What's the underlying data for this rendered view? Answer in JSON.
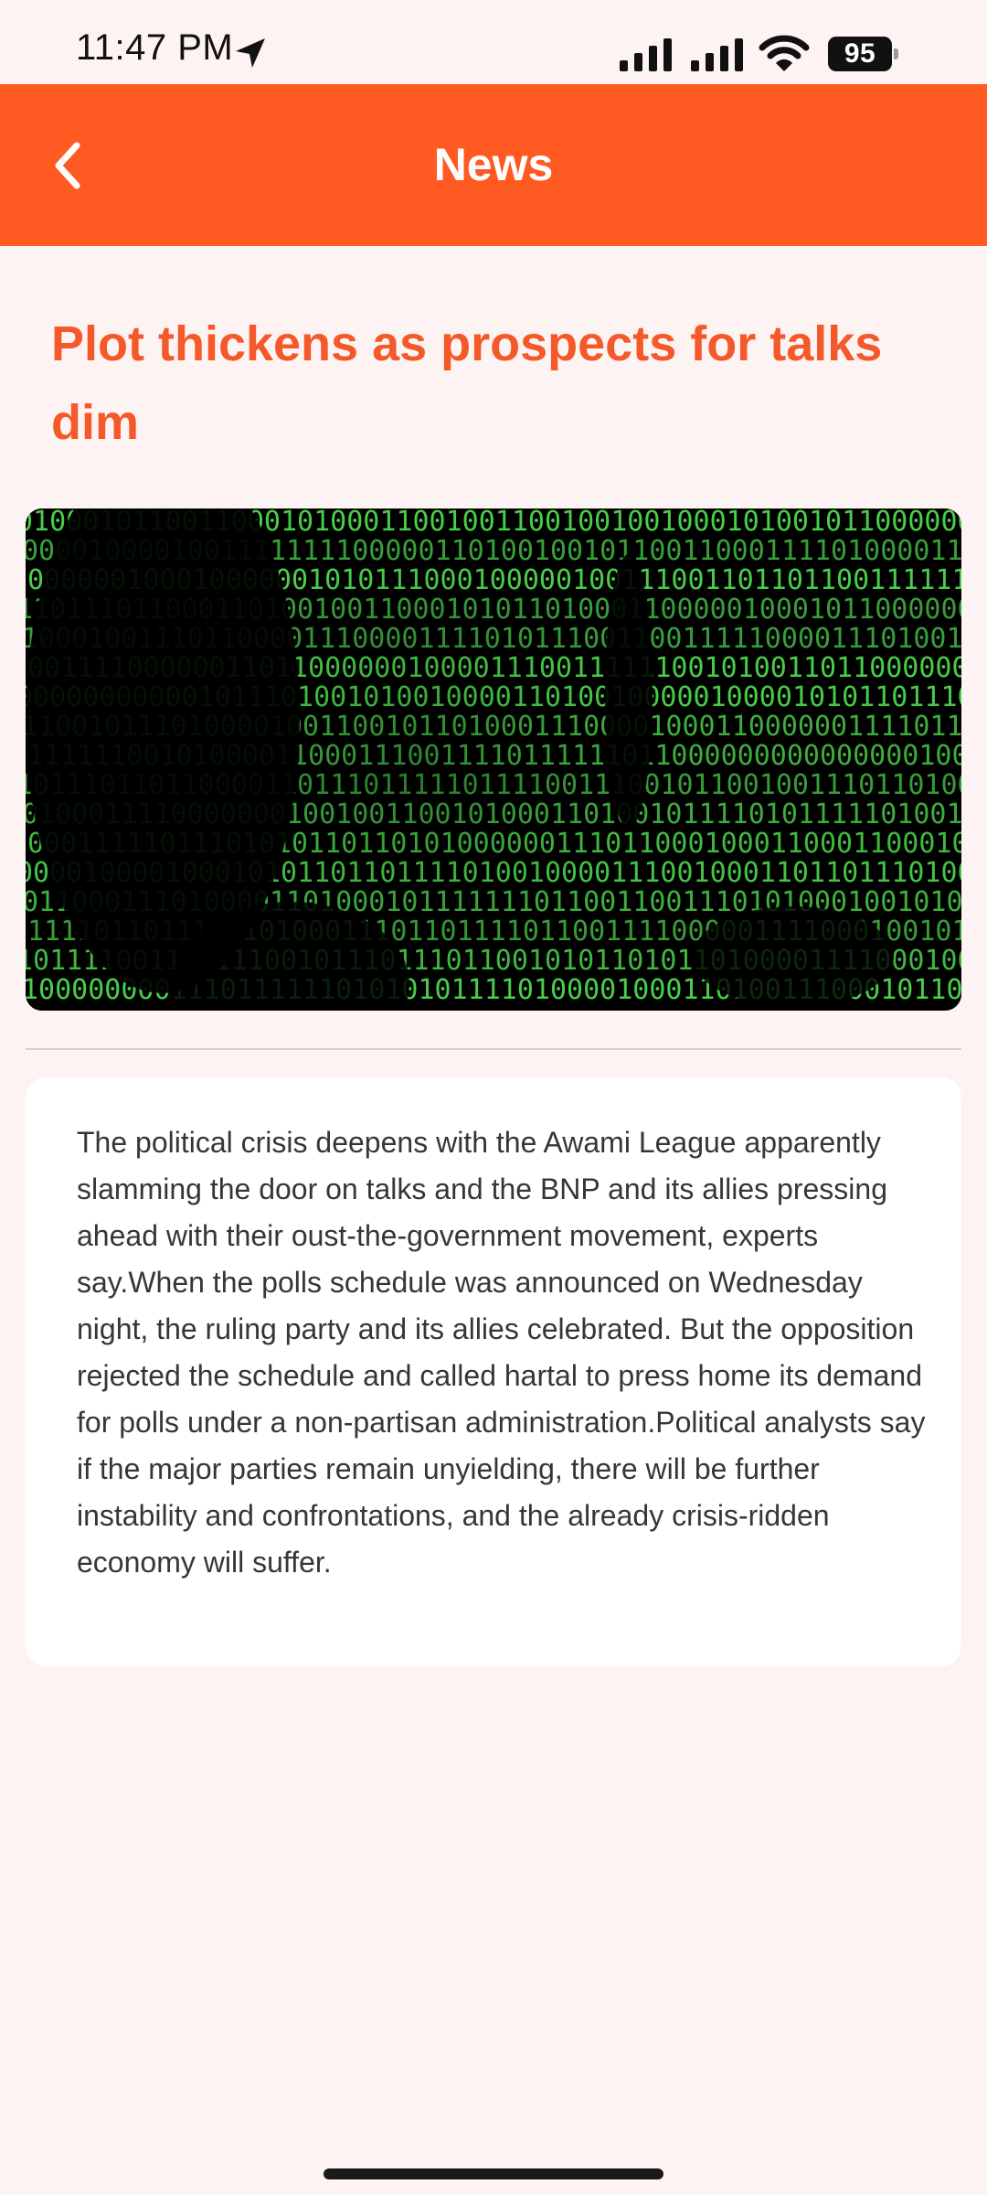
{
  "status_bar": {
    "time": "11:47 PM",
    "battery_level": "95",
    "icons": [
      "location-arrow-icon",
      "signal-icon",
      "signal-icon",
      "wifi-icon",
      "battery-icon"
    ]
  },
  "header": {
    "title": "News",
    "back_icon": "chevron-left-icon",
    "background_color": "#ff5a22"
  },
  "article": {
    "title": "Plot thickens as prospects for talks dim",
    "title_color": "#f4592a",
    "image_description_icon": "binary-code-image",
    "body": "The political crisis deepens with the Awami League apparently slamming the door on talks and the BNP and its allies pressing ahead with their oust-the-government movement, experts say.When the polls schedule was announced on Wednesday night, the ruling party and its allies celebrated. But the opposition rejected the schedule and called hartal to press home its demand for polls under a non-partisan administration.Political analysts say if the major parties remain unyielding, there will be further instability and confrontations, and the already crisis-ridden economy will suffer."
  }
}
